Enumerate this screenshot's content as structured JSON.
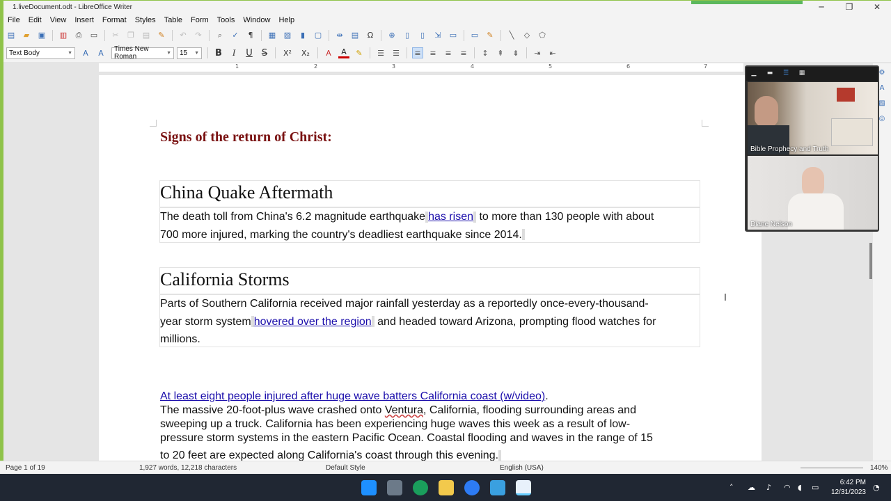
{
  "window": {
    "title": "1.liveDocument.odt - LibreOffice Writer",
    "controls": {
      "minimize": "─",
      "restore": "❐",
      "close": "✕"
    }
  },
  "menu": [
    "File",
    "Edit",
    "View",
    "Insert",
    "Format",
    "Styles",
    "Table",
    "Form",
    "Tools",
    "Window",
    "Help"
  ],
  "formatting": {
    "paragraph_style": "Text Body",
    "font_name": "Times New Roman",
    "font_size": "15",
    "bold": "B",
    "italic": "I",
    "underline": "U",
    "strikethrough": "S",
    "superscript": "X²",
    "subscript": "X₂"
  },
  "ruler": {
    "numbers": [
      "1",
      "2",
      "3",
      "4",
      "5",
      "6",
      "7"
    ]
  },
  "document": {
    "heading": "Signs of the return of Christ:",
    "sections": [
      {
        "title": "China Quake Aftermath",
        "line1_before": "The death toll from China's 6.2 magnitude earthquake",
        "link": "has risen",
        "line1_after": "to more than 130 people with about",
        "line2": "700 more injured, marking the country's deadliest earthquake since 2014."
      },
      {
        "title": "California Storms",
        "line1": "Parts of Southern California received major rainfall yesterday as a reportedly once-every-thousand-",
        "line2_before": "year storm system",
        "link": "hovered over the region",
        "line2_after": "and headed toward Arizona, prompting flood watches for",
        "line3": "millions."
      }
    ],
    "article": {
      "link": "At least eight people injured after huge wave batters California coast (w/video)",
      "link_period": ".",
      "line1_before": "The massive 20-foot-plus wave crashed onto",
      "line1_squiggle": "Ventura",
      "line1_after": ", California, flooding surrounding areas and",
      "line2": "sweeping up a truck. California has been experiencing huge waves this week as a result of low-",
      "line3": "pressure storm systems in the eastern Pacific Ocean. Coastal flooding and waves in the range of 15",
      "line4": "to 20 feet are expected along California's coast through this evening."
    }
  },
  "status": {
    "page": "Page 1 of 19",
    "words": "1,927 words, 12,218 characters",
    "style": "Default Style",
    "language": "English (USA)",
    "zoom": "140%"
  },
  "video_call": {
    "participants": [
      {
        "name": "Bible Prophecy and Truth"
      },
      {
        "name": "Diane Nelson"
      }
    ]
  },
  "taskbar": {
    "time": "6:42 PM",
    "date": "12/31/2023"
  }
}
